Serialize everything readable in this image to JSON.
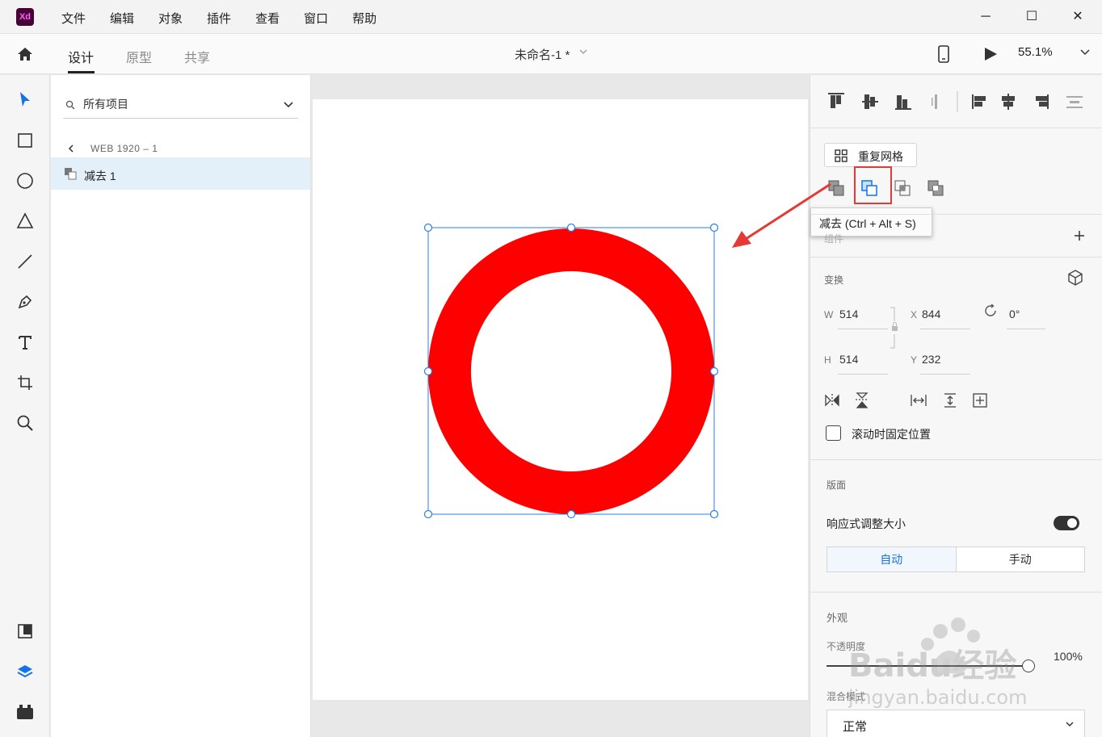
{
  "app": {
    "logo": "Xd"
  },
  "menu": [
    "文件",
    "编辑",
    "对象",
    "插件",
    "查看",
    "窗口",
    "帮助"
  ],
  "window_controls": {
    "minimize": "─",
    "maximize": "☐",
    "close": "✕"
  },
  "header": {
    "tabs": [
      "设计",
      "原型",
      "共享"
    ],
    "active_tab": "设计",
    "doc_title": "未命名-1 *",
    "zoom": "55.1%"
  },
  "tools": [
    "select-icon",
    "rectangle-icon",
    "ellipse-icon",
    "triangle-icon",
    "line-icon",
    "pen-icon",
    "text-icon",
    "artboard-icon",
    "zoom-icon",
    "assets-icon",
    "layers-icon",
    "plugins-icon"
  ],
  "layers": {
    "search_label": "所有项目",
    "breadcrumb": "WEB 1920 – 1",
    "items": [
      {
        "label": "减去 1",
        "selected": true
      }
    ]
  },
  "canvas": {
    "ring_color": "#ff0000",
    "selection_color": "#2680eb"
  },
  "right_panel": {
    "repeat_grid": "重复网格",
    "tooltip": "减去 (Ctrl + Alt + S)",
    "component_label": "组件",
    "transform_title": "变换",
    "w_label": "W",
    "w_value": "514",
    "x_label": "X",
    "x_value": "844",
    "h_label": "H",
    "h_value": "514",
    "y_label": "Y",
    "y_value": "232",
    "rotation": "0°",
    "fix_scroll": "滚动时固定位置",
    "layout_title": "版面",
    "responsive": "响应式调整大小",
    "responsive_on": true,
    "auto": "自动",
    "manual": "手动",
    "appearance_title": "外观",
    "opacity_label": "不透明度",
    "opacity_value": "100%",
    "blend_label": "混合模式",
    "blend_value": "正常"
  },
  "annotation": {
    "arrow_color": "#e53935",
    "highlight": "subtract-button"
  },
  "watermark": {
    "text": "Baidu经验",
    "url": "jingyan.baidu.com"
  }
}
